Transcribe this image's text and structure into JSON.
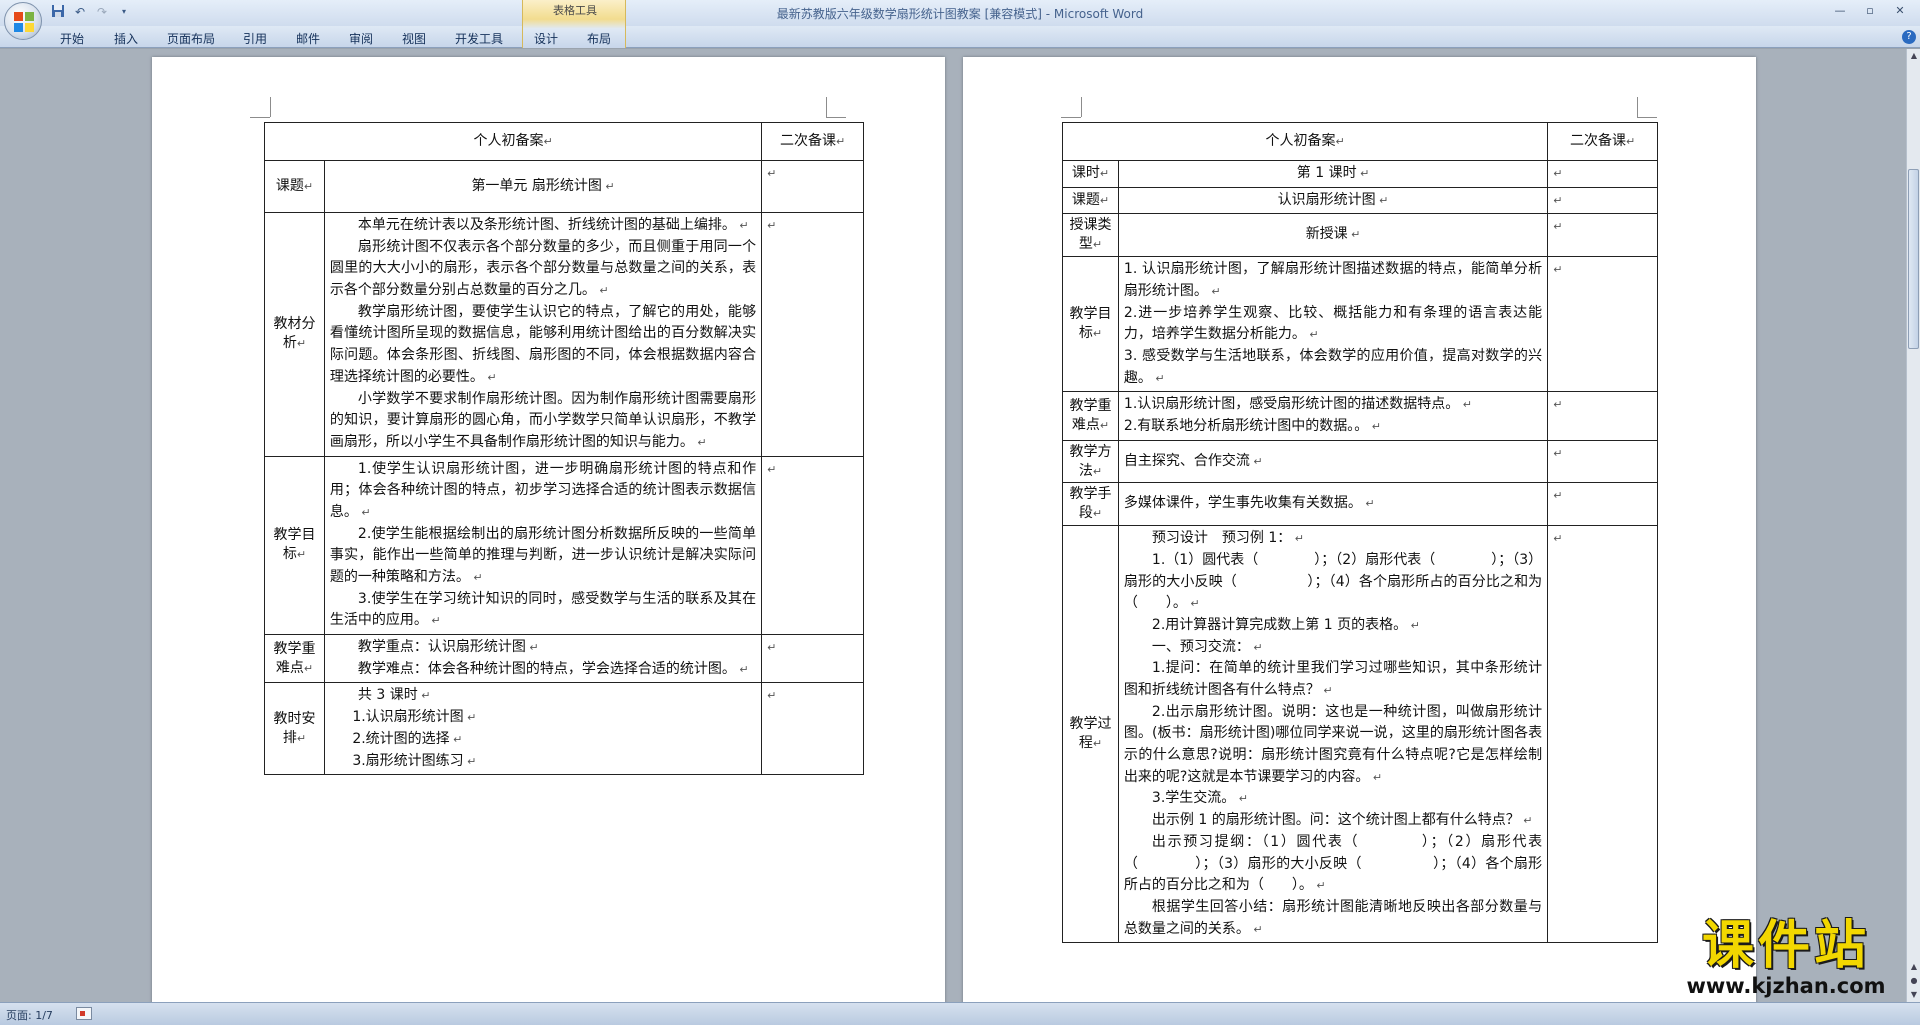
{
  "window": {
    "title": "最新苏教版六年级数学扇形统计图教案 [兼容模式] - Microsoft Word",
    "contextual_group": "表格工具"
  },
  "ribbon_tabs": [
    "开始",
    "插入",
    "页面布局",
    "引用",
    "邮件",
    "审阅",
    "视图",
    "开发工具",
    "设计",
    "布局"
  ],
  "status": {
    "page": "页面: 1/7"
  },
  "watermark": {
    "title": "课件站",
    "url": "www.kjzhan.com"
  },
  "page1": {
    "header_left": "个人初备案",
    "header_right": "二次备课",
    "rows": [
      {
        "label": "课题",
        "paras": [
          "第一单元 扇形统计图"
        ],
        "center": true
      },
      {
        "label": "教材分析",
        "paras": [
          "本单元在统计表以及条形统计图、折线统计图的基础上编排。",
          "扇形统计图不仅表示各个部分数量的多少，而且侧重于用同一个圆里的大大小小的扇形，表示各个部分数量与总数量之间的关系，表示各个部分数量分别占总数量的百分之几。",
          "教学扇形统计图，要使学生认识它的特点，了解它的用处，能够看懂统计图所呈现的数据信息，能够利用统计图给出的百分数解决实际问题。体会条形图、折线图、扇形图的不同，体会根据数据内容合理选择统计图的必要性。",
          "小学数学不要求制作扇形统计图。因为制作扇形统计图需要扇形的知识，要计算扇形的圆心角，而小学数学只简单认识扇形，不教学画扇形，所以小学生不具备制作扇形统计图的知识与能力。"
        ]
      },
      {
        "label": "教学目标",
        "paras": [
          "1.使学生认识扇形统计图，进一步明确扇形统计图的特点和作用；体会各种统计图的特点，初步学习选择合适的统计图表示数据信息。",
          "2.使学生能根据绘制出的扇形统计图分析数据所反映的一些简单事实，能作出一些简单的推理与判断，进一步认识统计是解决实际问题的一种策略和方法。",
          "3.使学生在学习统计知识的同时，感受数学与生活的联系及其在生活中的应用。"
        ]
      },
      {
        "label": "教学重难点",
        "paras": [
          "教学重点：认识扇形统计图",
          "教学难点：体会各种统计图的特点，学会选择合适的统计图。"
        ]
      },
      {
        "label": "教时安排",
        "paras": [
          "共 3 课时",
          "1.认识扇形统计图",
          "2.统计图的选择",
          "3.扇形统计图练习"
        ],
        "list": true
      }
    ]
  },
  "page2": {
    "header_left": "个人初备案",
    "header_right": "二次备课",
    "rows": [
      {
        "label": "课时",
        "paras": [
          "第 1 课时"
        ],
        "center": true
      },
      {
        "label": "课题",
        "paras": [
          "认识扇形统计图"
        ],
        "center": true
      },
      {
        "label": "授课类型",
        "paras": [
          "新授课"
        ],
        "center": true
      },
      {
        "label": "教学目标",
        "paras": [
          "1. 认识扇形统计图，了解扇形统计图描述数据的特点，能简单分析扇形统计图。",
          "2.进一步培养学生观察、比较、概括能力和有条理的语言表达能力，培养学生数据分析能力。",
          "3. 感受数学与生活地联系，体会数学的应用价值，提高对数学的兴趣。"
        ],
        "plain": true
      },
      {
        "label": "教学重难点",
        "paras": [
          "1.认识扇形统计图，感受扇形统计图的描述数据特点。",
          "2.有联系地分析扇形统计图中的数据。。"
        ],
        "plain": true
      },
      {
        "label": "教学方法",
        "paras": [
          "自主探究、合作交流"
        ],
        "plain": true
      },
      {
        "label": "教学手段",
        "paras": [
          "多媒体课件，学生事先收集有关数据。"
        ],
        "plain": true
      },
      {
        "label": "教学过程",
        "paras": [
          "预习设计　预习例 1：",
          "1.（1）圆代表（　　　　）；（2）扇形代表（　　　　）；（3）扇形的大小反映（　　　　　）；（4）各个扇形所占的百分比之和为（　　）。",
          "2.用计算器计算完成数上第 1 页的表格。",
          "一、预习交流：",
          "1.提问：在简单的统计里我们学习过哪些知识，其中条形统计图和折线统计图各有什么特点？",
          "2.出示扇形统计图。说明：这也是一种统计图，叫做扇形统计图。(板书：扇形统计图)哪位同学来说一说，这里的扇形统计图各表示的什么意思?说明：扇形统计图究竟有什么特点呢?它是怎样绘制出来的呢?这就是本节课要学习的内容。",
          "3.学生交流。",
          "出示例 1 的扇形统计图。问：这个统计图上都有什么特点？",
          "出示预习提纲：（1）圆代表（　　　　）；（2）扇形代表（　　　　）；（3）扇形的大小反映（　　　　　）；（4）各个扇形所占的百分比之和为（　　）。",
          "根据学生回答小结：扇形统计图能清晰地反映出各部分数量与总数量之间的关系。"
        ]
      }
    ]
  }
}
